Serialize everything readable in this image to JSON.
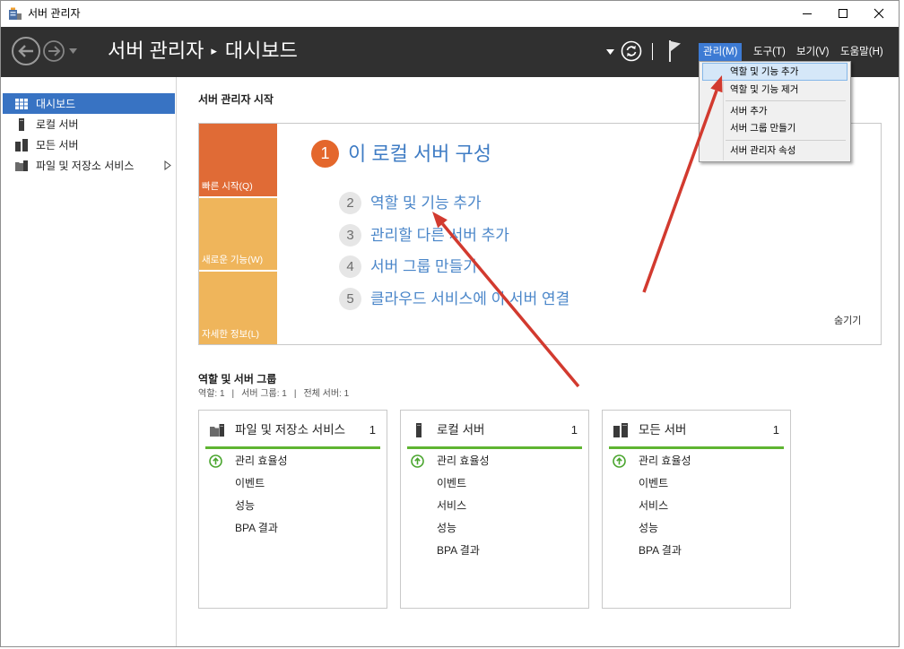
{
  "window": {
    "title": "서버 관리자",
    "icon": "server-manager-icon"
  },
  "header": {
    "breadcrumb": {
      "root": "서버 관리자",
      "separator": "▸",
      "current": "대시보드"
    },
    "nav_icons": [
      "back-arrow-icon",
      "forward-arrow-icon",
      "history-dropdown-icon"
    ],
    "tool_icons": [
      "refresh-dropdown-icon",
      "refresh-icon",
      "notifications-flag-icon"
    ],
    "menus": [
      {
        "label": "관리(M)",
        "open": true
      },
      {
        "label": "도구(T)",
        "open": false
      },
      {
        "label": "보기(V)",
        "open": false
      },
      {
        "label": "도움말(H)",
        "open": false
      }
    ]
  },
  "manage_menu": {
    "items": [
      {
        "label": "역할 및 기능 추가",
        "highlighted": true
      },
      {
        "label": "역할 및 기능 제거",
        "highlighted": false
      },
      {
        "label": "서버 추가",
        "highlighted": false
      },
      {
        "label": "서버 그룹 만들기",
        "highlighted": false
      },
      {
        "label": "서버 관리자 속성",
        "highlighted": false
      }
    ]
  },
  "sidebar": {
    "items": [
      {
        "label": "대시보드",
        "icon": "dashboard-icon",
        "selected": true
      },
      {
        "label": "로컬 서버",
        "icon": "local-server-icon",
        "selected": false
      },
      {
        "label": "모든 서버",
        "icon": "all-servers-icon",
        "selected": false
      },
      {
        "label": "파일 및 저장소 서비스",
        "icon": "file-storage-icon",
        "selected": false,
        "expandable": true
      }
    ]
  },
  "welcome": {
    "heading": "서버 관리자 시작",
    "side_tabs": [
      {
        "label": "빠른 시작(Q)",
        "color": "#e06b36"
      },
      {
        "label": "새로운 기능(W)",
        "color": "#efb55b"
      },
      {
        "label": "자세한 정보(L)",
        "color": "#efb55b"
      }
    ],
    "main_step": {
      "number": "1",
      "label": "이 로컬 서버 구성"
    },
    "steps": [
      {
        "number": "2",
        "label": "역할 및 기능 추가"
      },
      {
        "number": "3",
        "label": "관리할 다른 서버 추가"
      },
      {
        "number": "4",
        "label": "서버 그룹 만들기"
      },
      {
        "number": "5",
        "label": "클라우드 서비스에 이 서버 연결"
      }
    ],
    "hide_link": "숨기기"
  },
  "roles": {
    "heading": "역할 및 서버 그룹",
    "summary": [
      "역할: 1",
      "서버 그룹: 1",
      "전체 서버: 1"
    ],
    "summary_separator": "|",
    "tiles": [
      {
        "title": "파일 및 저장소 서비스",
        "count": "1",
        "icon": "file-storage-icon",
        "items": [
          {
            "label": "관리 효율성",
            "status_icon": "status-ok-icon"
          },
          {
            "label": "이벤트"
          },
          {
            "label": "성능"
          },
          {
            "label": "BPA 결과"
          }
        ]
      },
      {
        "title": "로컬 서버",
        "count": "1",
        "icon": "local-server-icon",
        "items": [
          {
            "label": "관리 효율성",
            "status_icon": "status-ok-icon"
          },
          {
            "label": "이벤트"
          },
          {
            "label": "서비스"
          },
          {
            "label": "성능"
          },
          {
            "label": "BPA 결과"
          }
        ]
      },
      {
        "title": "모든 서버",
        "count": "1",
        "icon": "all-servers-icon",
        "items": [
          {
            "label": "관리 효율성",
            "status_icon": "status-ok-icon"
          },
          {
            "label": "이벤트"
          },
          {
            "label": "서비스"
          },
          {
            "label": "성능"
          },
          {
            "label": "BPA 결과"
          }
        ]
      }
    ]
  },
  "annotations": {
    "arrow_color": "#d23a2f"
  },
  "colors": {
    "header_bg": "#303030",
    "menu_open_bg": "#3d7bd4",
    "menu_bg": "#f0f0f0",
    "menu_highlight_bg": "#d5e7f8",
    "sidebar_selected_bg": "#3873c3",
    "link_blue": "#4a86c9",
    "step1_orange": "#e4672c",
    "status_green": "#5fb532"
  }
}
